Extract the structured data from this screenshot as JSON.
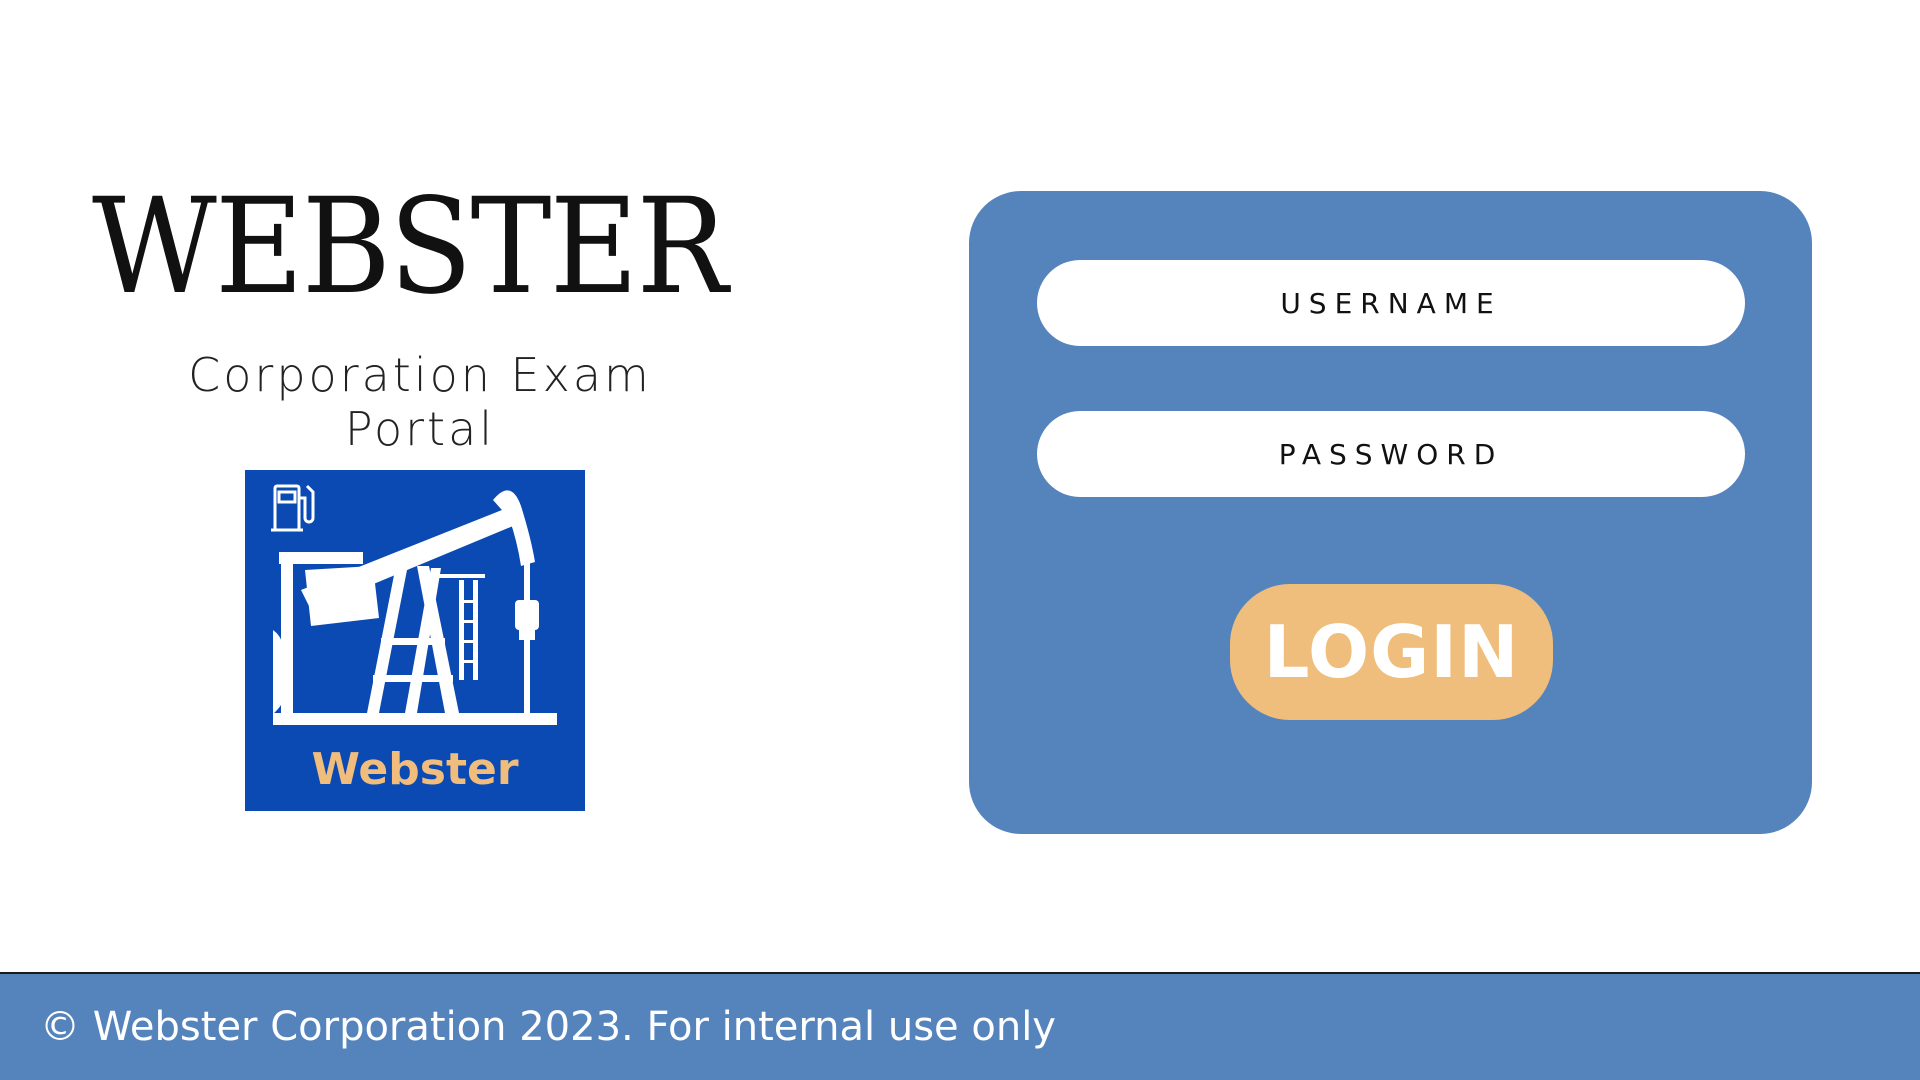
{
  "brand": {
    "title": "WEBSTER",
    "subtitle": "Corporation Exam Portal"
  },
  "logo": {
    "text": "Webster",
    "icon": "pumpjack-icon",
    "fuel_icon": "fuel-pump-icon",
    "background_color": "#0b4ab2",
    "text_color": "#f0bd7c"
  },
  "login_form": {
    "username_placeholder": "USERNAME",
    "password_placeholder": "PASSWORD",
    "username_value": "",
    "password_value": "",
    "login_label": "LOGIN",
    "panel_color": "#5584bd",
    "button_color": "#efbd7c"
  },
  "footer": {
    "text": "© Webster Corporation 2023. For internal use only",
    "color": "#5584bd"
  }
}
